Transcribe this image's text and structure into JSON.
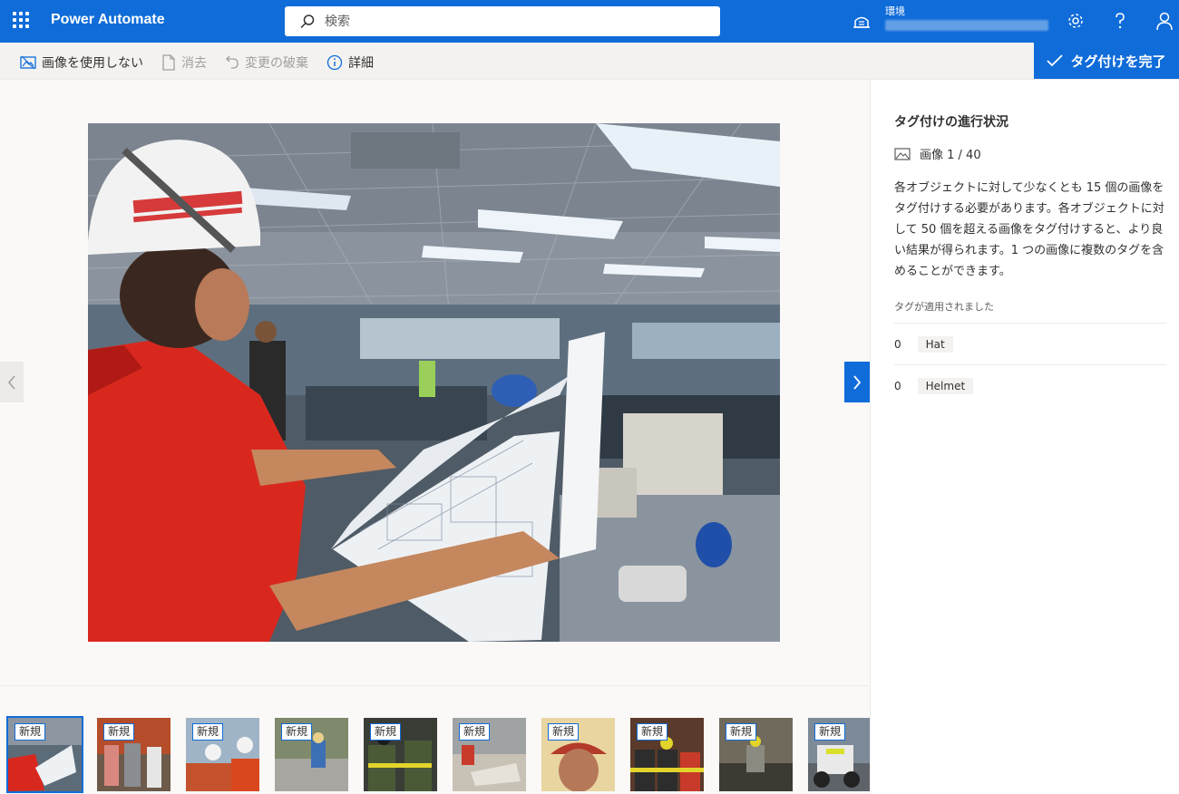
{
  "header": {
    "app_title": "Power Automate",
    "search_placeholder": "検索",
    "environment_label": "環境"
  },
  "toolbar": {
    "no_image_label": "画像を使用しない",
    "clear_label": "消去",
    "discard_label": "変更の破棄",
    "details_label": "詳細",
    "finish_label": "タグ付けを完了"
  },
  "panel": {
    "title": "タグ付けの進行状況",
    "image_counter": "画像 1 / 40",
    "description": "各オブジェクトに対して少なくとも 15 個の画像をタグ付けする必要があります。各オブジェクトに対して 50 個を超える画像をタグ付けすると、より良い結果が得られます。1 つの画像に複数のタグを含めることができます。",
    "applied_label": "タグが適用されました",
    "tags": [
      {
        "count": "0",
        "name": "Hat"
      },
      {
        "count": "0",
        "name": "Helmet"
      }
    ]
  },
  "filmstrip": {
    "badge": "新規",
    "thumbnails": [
      {
        "badge": "新規",
        "selected": true
      },
      {
        "badge": "新規"
      },
      {
        "badge": "新規"
      },
      {
        "badge": "新規"
      },
      {
        "badge": "新規"
      },
      {
        "badge": "新規"
      },
      {
        "badge": "新規"
      },
      {
        "badge": "新規"
      },
      {
        "badge": "新規"
      },
      {
        "badge": "新規"
      }
    ]
  },
  "colors": {
    "brand": "#0f6cd9",
    "command_bar": "#f3f2f1",
    "stage": "#faf9f8"
  },
  "icons": [
    "waffle-icon",
    "search-icon",
    "environment-icon",
    "settings-icon",
    "help-icon",
    "account-icon",
    "no-image-icon",
    "clear-icon",
    "undo-icon",
    "info-icon",
    "checkmark-icon",
    "chevron-left-icon",
    "chevron-right-icon",
    "image-icon"
  ]
}
